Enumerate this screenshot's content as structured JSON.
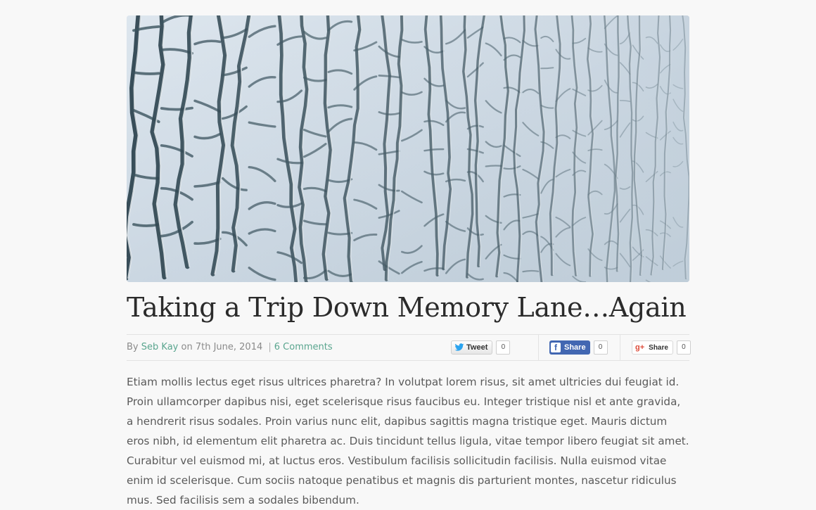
{
  "post": {
    "hero_image": "cracked-glass-photo",
    "title": "Taking a Trip Down Memory Lane…Again",
    "meta": {
      "by_label": "By",
      "author": "Seb Kay",
      "on_label": "on",
      "date": "7th June, 2014",
      "separator": "|",
      "comments": "6 Comments"
    },
    "share": {
      "twitter": {
        "label": "Tweet",
        "count": "0",
        "icon": "twitter-bird-icon"
      },
      "facebook": {
        "label": "Share",
        "count": "0",
        "icon": "facebook-f-icon"
      },
      "google_plus": {
        "label": "Share",
        "count": "0",
        "icon": "google-plus-icon"
      }
    },
    "body": "Etiam mollis lectus eget risus ultrices pharetra? In volutpat lorem risus, sit amet ultricies dui feugiat id. Proin ullamcorper dapibus nisi, eget scelerisque risus faucibus eu. Integer tristique nisl et ante gravida, a hendrerit risus sodales. Proin varius nunc elit, dapibus sagittis magna tristique eget. Mauris dictum eros nibh, id elementum elit pharetra ac. Duis tincidunt tellus ligula, vitae tempor libero feugiat sit amet. Curabitur vel euismod mi, at luctus eros. Vestibulum facilisis sollicitudin facilisis. Nulla euismod vitae enim id scelerisque. Cum sociis natoque penatibus et magnis dis parturient montes, nascetur ridiculus mus. Sed facilisis sem a sodales bibendum."
  },
  "colors": {
    "link": "#59a58e",
    "title": "#2b2b2b",
    "body_text": "#5a5a5a",
    "facebook": "#4267b2",
    "google_plus": "#dd4b39",
    "background": "#f8f8f8"
  }
}
